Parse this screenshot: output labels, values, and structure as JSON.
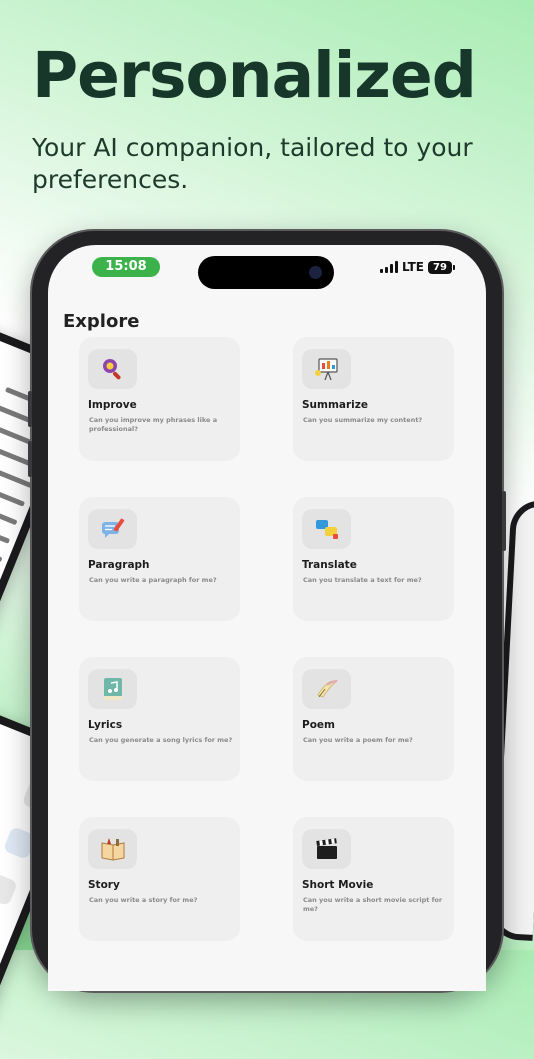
{
  "hero": {
    "title": "Personalized",
    "subtitle": "Your AI companion, tailored to your preferences."
  },
  "status_bar": {
    "time": "15:08",
    "network": "LTE",
    "battery": "79"
  },
  "explore": {
    "title": "Explore",
    "cards": [
      {
        "title": "Improve",
        "desc": "Can you improve my phrases like a professional?",
        "icon": "magnifier-gear-icon"
      },
      {
        "title": "Summarize",
        "desc": "Can you summarize my content?",
        "icon": "presentation-board-icon"
      },
      {
        "title": "Paragraph",
        "desc": "Can you write a paragraph for me?",
        "icon": "chat-pencil-icon"
      },
      {
        "title": "Translate",
        "desc": "Can you translate a text for me?",
        "icon": "translate-bubbles-icon"
      },
      {
        "title": "Lyrics",
        "desc": "Can you generate a song lyrics for me?",
        "icon": "music-book-icon"
      },
      {
        "title": "Poem",
        "desc": "Can you write a poem for me?",
        "icon": "quill-scroll-icon"
      },
      {
        "title": "Story",
        "desc": "Can you write a story for me?",
        "icon": "storybook-icon"
      },
      {
        "title": "Short Movie",
        "desc": "Can you write a short movie script for me?",
        "icon": "clapperboard-icon"
      }
    ]
  },
  "colors": {
    "headline": "#17372a",
    "accent_green": "#3bb34a",
    "card_bg": "#efefef"
  }
}
